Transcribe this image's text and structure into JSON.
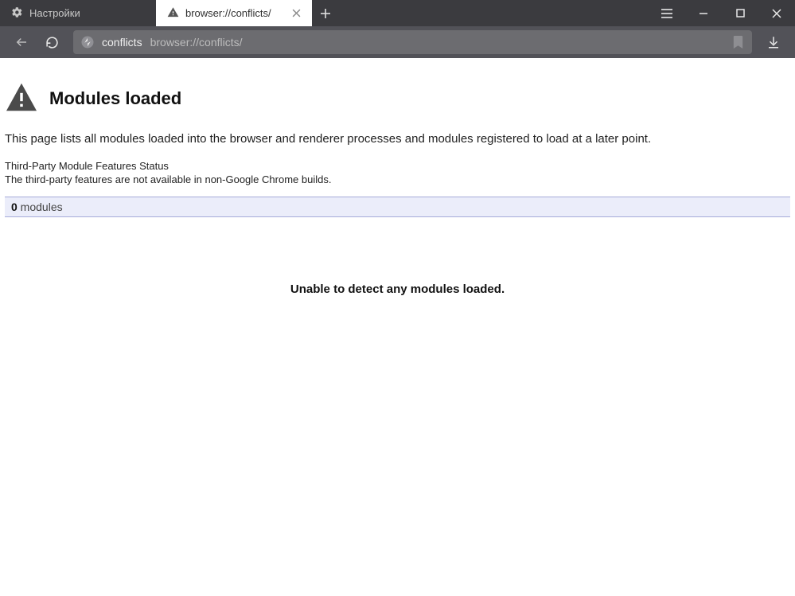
{
  "tabs": {
    "inactive": {
      "label": "Настройки"
    },
    "active": {
      "label": "browser://conflicts/"
    }
  },
  "address": {
    "host": "conflicts",
    "path": "browser://conflicts/"
  },
  "page": {
    "heading": "Modules loaded",
    "desc": "This page lists all modules loaded into the browser and renderer processes and modules registered to load at a later point.",
    "feature_status": "Third-Party Module Features Status",
    "feature_note": "The third-party features are not available in non-Google Chrome builds.",
    "modules_count": "0",
    "modules_word": " modules",
    "empty": "Unable to detect any modules loaded."
  }
}
